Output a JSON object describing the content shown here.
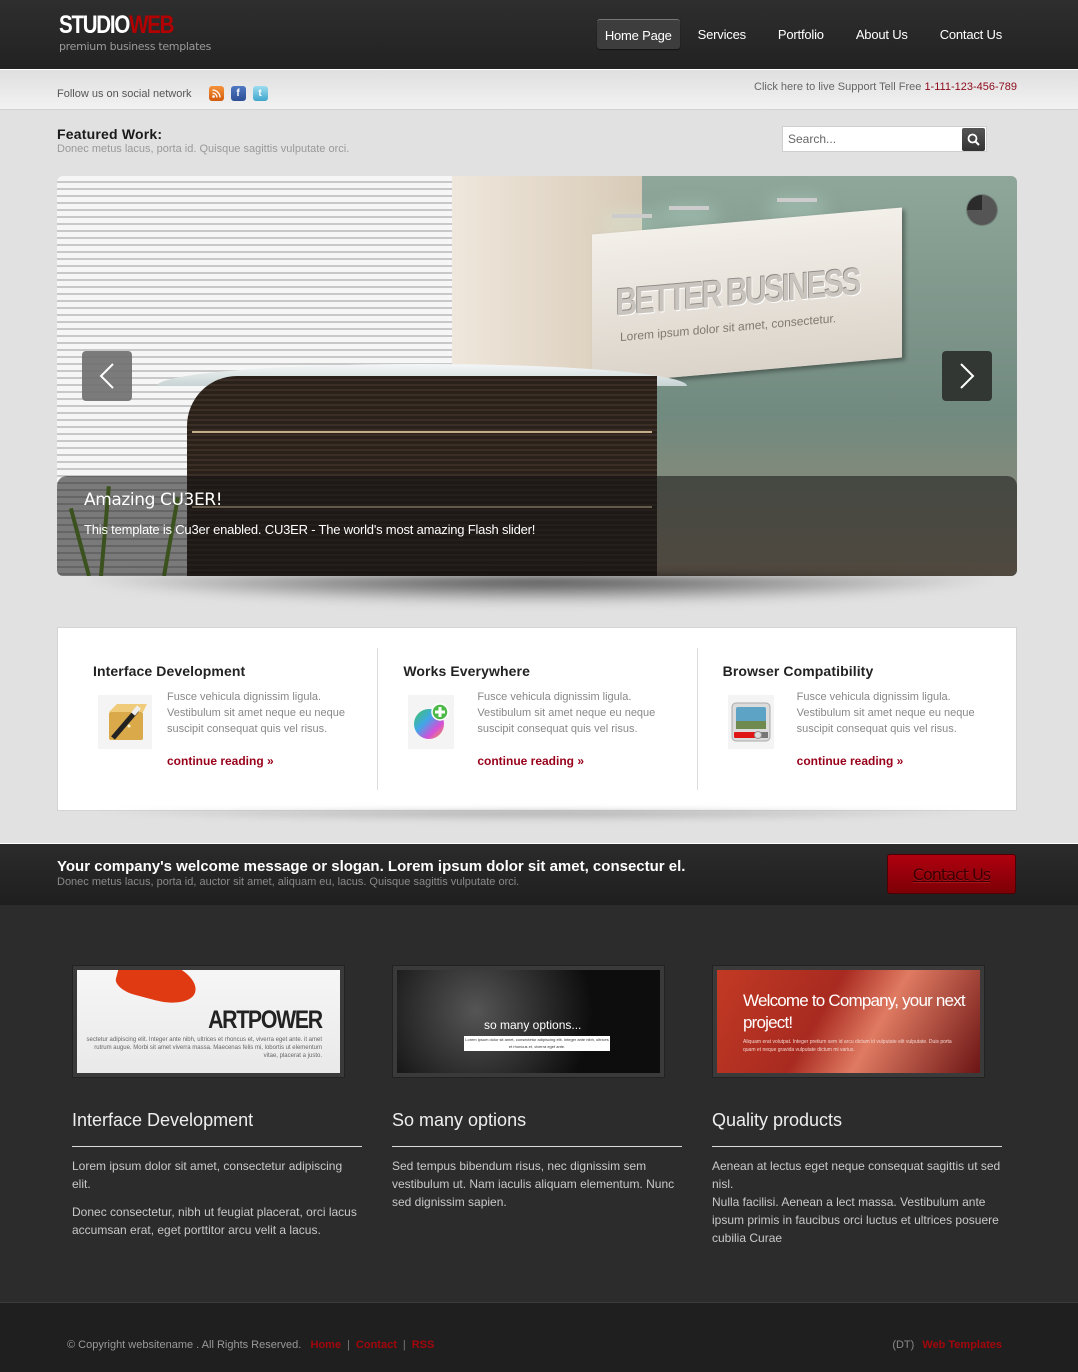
{
  "header": {
    "logo": {
      "part1": "STUDIO",
      "part2": "WEB",
      "tagline": "premium business templates"
    },
    "nav": [
      {
        "label": "Home Page",
        "active": true
      },
      {
        "label": "Services",
        "active": false
      },
      {
        "label": "Portfolio",
        "active": false
      },
      {
        "label": "About Us",
        "active": false
      },
      {
        "label": "Contact Us",
        "active": false
      }
    ]
  },
  "social_bar": {
    "follow_text": "Follow us on social network",
    "icons": [
      "rss-icon",
      "facebook-icon",
      "twitter-icon"
    ],
    "support_text": "Click here to live Support Tell Free",
    "phone": "1-111-123-456-789"
  },
  "featured": {
    "title": "Featured Work:",
    "subtitle": "Donec metus lacus, porta id. Quisque sagittis vulputate orci.",
    "search_placeholder": "Search..."
  },
  "slider": {
    "sign_title": "BETTER BUSINESS",
    "sign_subtitle": "Lorem ipsum dolor sit amet, consectetur.",
    "caption_title": "Amazing CU3ER!",
    "caption_text": "This template is Cu3er enabled. CU3ER - The world's most amazing Flash slider!",
    "timer_progress": 0.75
  },
  "features": [
    {
      "title": "Interface Development",
      "icon": "magic-wand-box-icon",
      "text": "Fusce vehicula dignissim ligula. Vestibulum sit amet neque eu neque suscipit consequat quis vel risus.",
      "link": "continue reading »"
    },
    {
      "title": "Works Everywhere",
      "icon": "color-wheel-add-icon",
      "text": "Fusce vehicula dignissim ligula. Vestibulum sit amet neque eu neque suscipit consequat quis vel risus.",
      "link": "continue reading »"
    },
    {
      "title": "Browser Compatibility",
      "icon": "media-player-icon",
      "text": "Fusce vehicula dignissim ligula. Vestibulum sit amet neque eu neque suscipit consequat quis vel risus.",
      "link": "continue reading »"
    }
  ],
  "welcome": {
    "headline": "Your company's welcome message or slogan. Lorem ipsum dolor sit amet, consectur el.",
    "subtext": "Donec metus lacus, porta id, auctor sit amet, aliquam eu, lacus. Quisque sagittis vulputate orci.",
    "button": "Contact Us"
  },
  "portfolio": [
    {
      "thumb_title": "ARTPOWER",
      "thumb_text": "sectetur adipiscing elit. Integer ante nibh, ultrices et rhoncus et, viverra eget ante. it amet rutrum augue. Morbi sit amet viverra massa. Maecenas felis mi, lobortis ut elementum vitae, placerat a justo.",
      "title": "Interface Development",
      "paragraphs": [
        "Lorem ipsum dolor sit amet, consectetur adipiscing elit.",
        "Donec consectetur, nibh ut feugiat placerat, orci lacus accumsan erat, eget porttitor arcu velit a lacus."
      ]
    },
    {
      "thumb_title": "so many options...",
      "thumb_text": "Lorem ipsum dolor sit amet, consectetur adipiscing elit. Integer ante nibh, ultrices et rhoncus et, viverra eget ante.",
      "title": "So many options",
      "paragraphs": [
        "Sed tempus bibendum risus, nec dignissim sem vestibulum ut. Nam iaculis aliquam elementum. Nunc sed dignissim sapien."
      ]
    },
    {
      "thumb_title": "Welcome to Company, your next project!",
      "thumb_text": "Aliquam erat volutpat. Integer pretium sem id arcu dictum id vulputate elit vulputate. Duis porta quam et neque gravida vulputate dictum mi varius.",
      "title": "Quality products",
      "paragraphs": [
        "Aenean at lectus eget neque consequat sagittis ut sed nisl.",
        "Nulla facilisi. Aenean a lect massa. Vestibulum ante ipsum primis in faucibus orci luctus et ultrices posuere cubilia Curae"
      ]
    }
  ],
  "footer": {
    "copyright": "© Copyright websitename . All Rights Reserved.",
    "links": [
      "Home",
      "Contact",
      "RSS"
    ],
    "separator": "|",
    "credit_prefix": "(DT)",
    "credit_link": "Web Templates"
  },
  "colors": {
    "brand_red": "#b30000",
    "link_red": "#98001a",
    "dark_bg": "#2c2c2c",
    "light_bg": "#e1e1e1"
  }
}
